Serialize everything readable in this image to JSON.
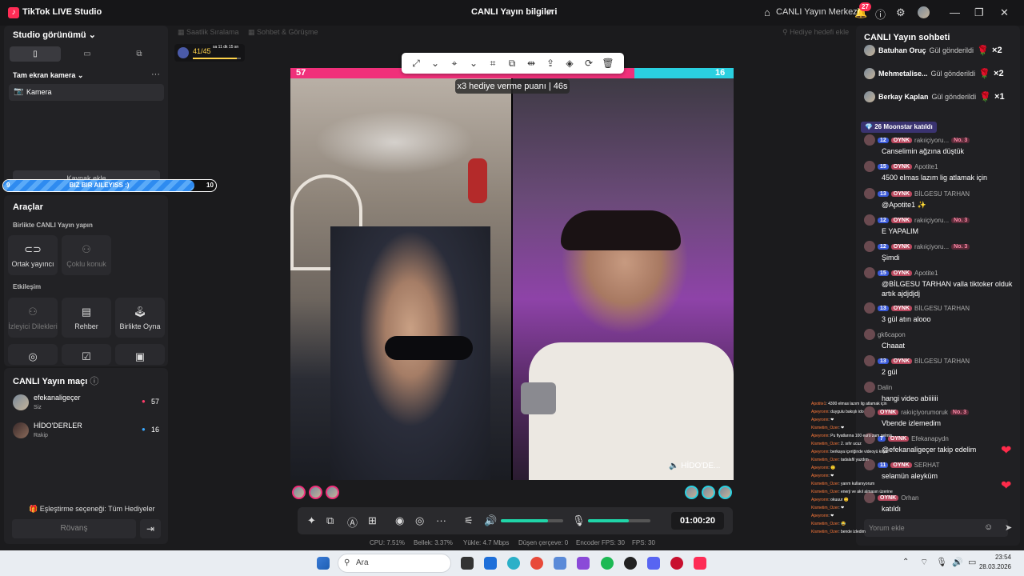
{
  "titlebar": {
    "app_name": "TikTok LIVE Studio",
    "center_title": "CANLI Yayın bilgileri",
    "live_center": "CANLI Yayın Merkezi",
    "notification_count": "27"
  },
  "left": {
    "studio_view": "Studio görünümü",
    "camera_section": "Tam ekran kamera",
    "camera_item": "Kamera",
    "source_add": "Kaynak ekle",
    "tools": "Araçlar",
    "together": "Birlikte CANLI Yayın yapın",
    "co_host": "Ortak yayıncı",
    "multi_guest": "Çoklu konuk",
    "interaction": "Etkileşim",
    "viewer_requests": "İzleyici Dilekleri",
    "guide": "Rehber",
    "play_together": "Birlikte Oyna",
    "match_title": "CANLI Yayın maçı",
    "player1_name": "efekanaligeçer",
    "player1_role": "Siz",
    "player1_score": "57",
    "player2_name": "HİDO'DERLER",
    "player2_role": "Rakip",
    "player2_score": "16",
    "match_option": "Eşleştirme seçeneği: Tüm Hediyeler",
    "rematch": "Rövanş"
  },
  "bizbar": {
    "left": "9",
    "label": "BIZ BIR AILEYISS :)",
    "right": "10",
    "fill": 0.9
  },
  "ghosts": {
    "hourly": "Saatlik Sıralama",
    "chat_meet": "Sohbet & Görüşme",
    "gift_goal": "Hediye hedefi ekle"
  },
  "goal": {
    "value": "41/45",
    "time": "sa 11 dk 15 sn"
  },
  "battle": {
    "left_score": "57",
    "right_score": "16",
    "gift_tip": "x3 hediye verme puanı",
    "gift_tip_time": "46s",
    "right_name": "HİDO'DE..."
  },
  "controls": {
    "timer": "01:00:20",
    "volume": 0.75,
    "mic": 0.65
  },
  "stats": {
    "cpu": "CPU:  7.51%",
    "memory": "Bellek:  3.37%",
    "upload": "Yükle:  4.7 Mbps",
    "dropped": "Düşen çerçeve:  0",
    "encoder_fps": "Encoder FPS:  30",
    "fps": "FPS:  30"
  },
  "chat": {
    "title": "CANLI Yayın sohbeti",
    "gifts": [
      {
        "name": "Batuhan Oruç",
        "action": "Gül gönderildi",
        "mult": "×2"
      },
      {
        "name": "Mehmetalise...",
        "action": "Gül gönderildi",
        "mult": "×2"
      },
      {
        "name": "Berkay Kaplan",
        "action": "Gül gönderildi",
        "mult": "×1"
      }
    ],
    "join_badge_level": "26",
    "join_badge_text": "Moonstar katıldı",
    "messages": [
      {
        "lvl": "12",
        "fan": "OYNK",
        "user": "rakıiçiyoru...",
        "no": "No. 3",
        "text": "Canselimin ağzına düştük"
      },
      {
        "lvl": "15",
        "fan": "OYNK",
        "user": "Apotite1",
        "no": "",
        "text": "4500 elmas lazım lig atlamak için"
      },
      {
        "lvl": "13",
        "fan": "OYNK",
        "user": "BİLGESU TARHAN",
        "no": "",
        "text": "@Apotite1 ✨"
      },
      {
        "lvl": "12",
        "fan": "OYNK",
        "user": "rakıiçiyoru...",
        "no": "No. 3",
        "text": "E YAPALIM"
      },
      {
        "lvl": "12",
        "fan": "OYNK",
        "user": "rakıiçiyoru...",
        "no": "No. 3",
        "text": "Şimdi"
      },
      {
        "lvl": "15",
        "fan": "OYNK",
        "user": "Apotite1",
        "no": "",
        "text": "@BİLGESU TARHAN valla tiktoker olduk artık ajdjdjdj"
      },
      {
        "lvl": "13",
        "fan": "OYNK",
        "user": "BİLGESU TARHAN",
        "no": "",
        "text": "3 gül atın alooo"
      },
      {
        "lvl": "",
        "fan": "",
        "user": "gk6capon",
        "no": "",
        "text": "Chaaat"
      },
      {
        "lvl": "13",
        "fan": "OYNK",
        "user": "BİLGESU TARHAN",
        "no": "",
        "text": "2 gül"
      },
      {
        "lvl": "",
        "fan": "",
        "user": "Dalin",
        "no": "",
        "text": "hangi video abiiiiii"
      },
      {
        "lvl": "",
        "fan": "OYNK",
        "user": "rakıiçiyorumoruk",
        "no": "No. 3",
        "text": "Vbende izlemedim"
      },
      {
        "lvl": "7",
        "fan": "OYNK",
        "user": "Efekanapydn",
        "no": "",
        "text": "@efekanaligeçer takip edelim"
      },
      {
        "lvl": "11",
        "fan": "OYNK",
        "user": "SERHAT",
        "no": "",
        "text": "selamün aleyküm"
      },
      {
        "lvl": "",
        "fan": "OYNK",
        "user": "Orhan",
        "no": "",
        "text": "katıldı"
      }
    ],
    "input_placeholder": "Yorum ekle"
  },
  "overlay_chat": [
    [
      "Apotite1",
      ": 4300 elmas lazım lig atlamak için"
    ],
    [
      "Apeyronn",
      ": duygulu bakışlı ido"
    ],
    [
      "Apeyronn",
      ": ❤"
    ],
    [
      "Kismetim_Ozer",
      ": ❤"
    ],
    [
      "Apeyronn",
      ": Pu fiyatlarına 100 euro zam gelmiş"
    ],
    [
      "Kismetim_Ozer",
      ": 2. sıfır ucuz"
    ],
    [
      "Apeyronn",
      ": berkaya içeriğinde videoyü koyar"
    ],
    [
      "Kismetim_Ozer",
      ": tadalafil yazdım"
    ],
    [
      "Apeyronn",
      ": 🙂"
    ],
    [
      "Apeyronn",
      ": ❤"
    ],
    [
      "Kismetim_Ozer",
      ": yarım kullanıyorum"
    ],
    [
      "Kismetim_Ozer",
      ": enerji ve akıl almasın üzerine"
    ],
    [
      "Apeyronn",
      ": okuuur 😊"
    ],
    [
      "Kismetim_Ozer",
      ": ❤"
    ],
    [
      "Apeyronn",
      ": ❤"
    ],
    [
      "Kismetim_Ozer",
      ": 😂"
    ],
    [
      "Kismetim_Ozer",
      ": bende izledim"
    ]
  ],
  "taskbar": {
    "search": "Ara",
    "time": "23:54",
    "date": "28.03.2026"
  }
}
